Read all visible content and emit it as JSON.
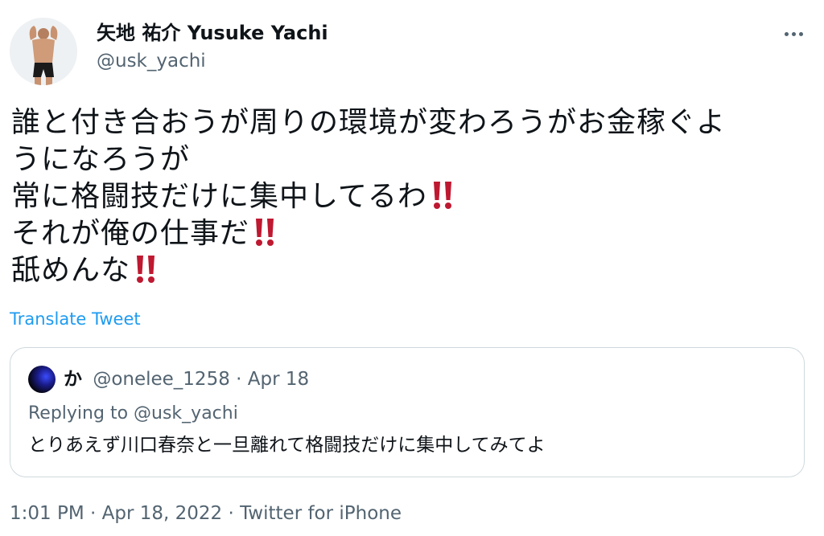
{
  "user": {
    "display_name": "矢地 祐介 Yusuke Yachi",
    "handle": "@usk_yachi",
    "avatar_icon": "profile-photo-fighter"
  },
  "more_icon": "more-options-icon",
  "tweet": {
    "lines": [
      {
        "text": "誰と付き合おうが周りの環境が変わろうがお金稼ぐよ",
        "emoji": null
      },
      {
        "text": "うになろうが",
        "emoji": null
      },
      {
        "text": "常に格闘技だけに集中してるわ",
        "emoji": "double-exclamation-mark"
      },
      {
        "text": "それが俺の仕事だ",
        "emoji": "double-exclamation-mark"
      },
      {
        "text": "舐めんな",
        "emoji": "double-exclamation-mark"
      }
    ],
    "translate_label": "Translate Tweet",
    "timestamp": "1:01 PM · Apr 18, 2022 · Twitter for iPhone"
  },
  "quote": {
    "name": "か",
    "handle": "@onelee_1258",
    "date": "· Apr 18",
    "replying_prefix": "Replying to",
    "replying_handle": "@usk_yachi",
    "text": "とりあえず川口春奈と一旦離れて格闘技だけに集中してみてよ"
  },
  "colors": {
    "link": "#1d9bf0",
    "secondary_text": "#536471",
    "border": "#cfd9de",
    "emoji_red": "#be1931"
  }
}
